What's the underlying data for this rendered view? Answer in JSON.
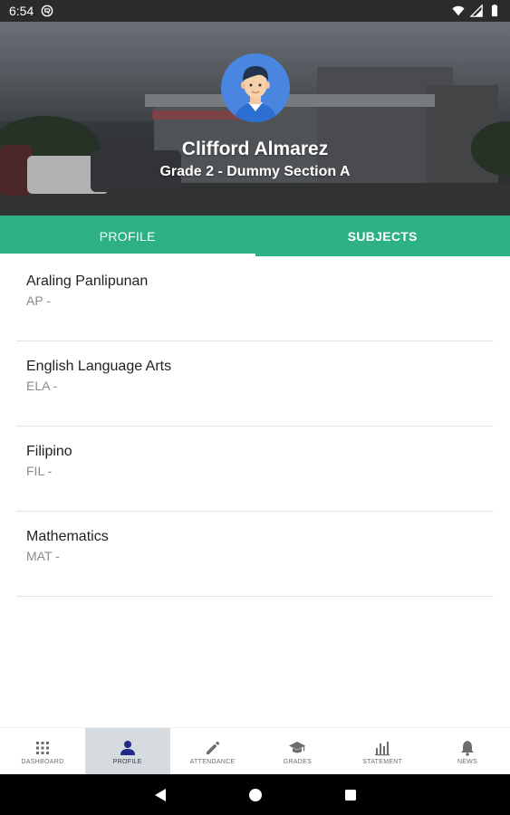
{
  "status_bar": {
    "time": "6:54"
  },
  "header": {
    "student_name": "Clifford  Almarez",
    "grade_section": "Grade 2 - Dummy Section A"
  },
  "tabs": [
    {
      "label": "PROFILE",
      "active": false
    },
    {
      "label": "SUBJECTS",
      "active": true
    }
  ],
  "subjects": [
    {
      "name": "Araling Panlipunan",
      "code": "AP -"
    },
    {
      "name": "English Language Arts",
      "code": "ELA -"
    },
    {
      "name": "Filipino",
      "code": "FIL -"
    },
    {
      "name": "Mathematics",
      "code": "MAT -"
    }
  ],
  "bottom_nav": [
    {
      "label": "DASHBOARD",
      "icon": "grid-icon",
      "active": false
    },
    {
      "label": "PROFILE",
      "icon": "person-icon",
      "active": true
    },
    {
      "label": "ATTENDANCE",
      "icon": "pencil-icon",
      "active": false
    },
    {
      "label": "GRADES",
      "icon": "graduation-cap-icon",
      "active": false
    },
    {
      "label": "STATEMENT",
      "icon": "bar-chart-icon",
      "active": false
    },
    {
      "label": "NEWS",
      "icon": "bell-icon",
      "active": false
    }
  ],
  "colors": {
    "accent": "#2eb087",
    "avatar_bg": "#4a86e0",
    "active_nav_bg": "#d5dbde"
  }
}
